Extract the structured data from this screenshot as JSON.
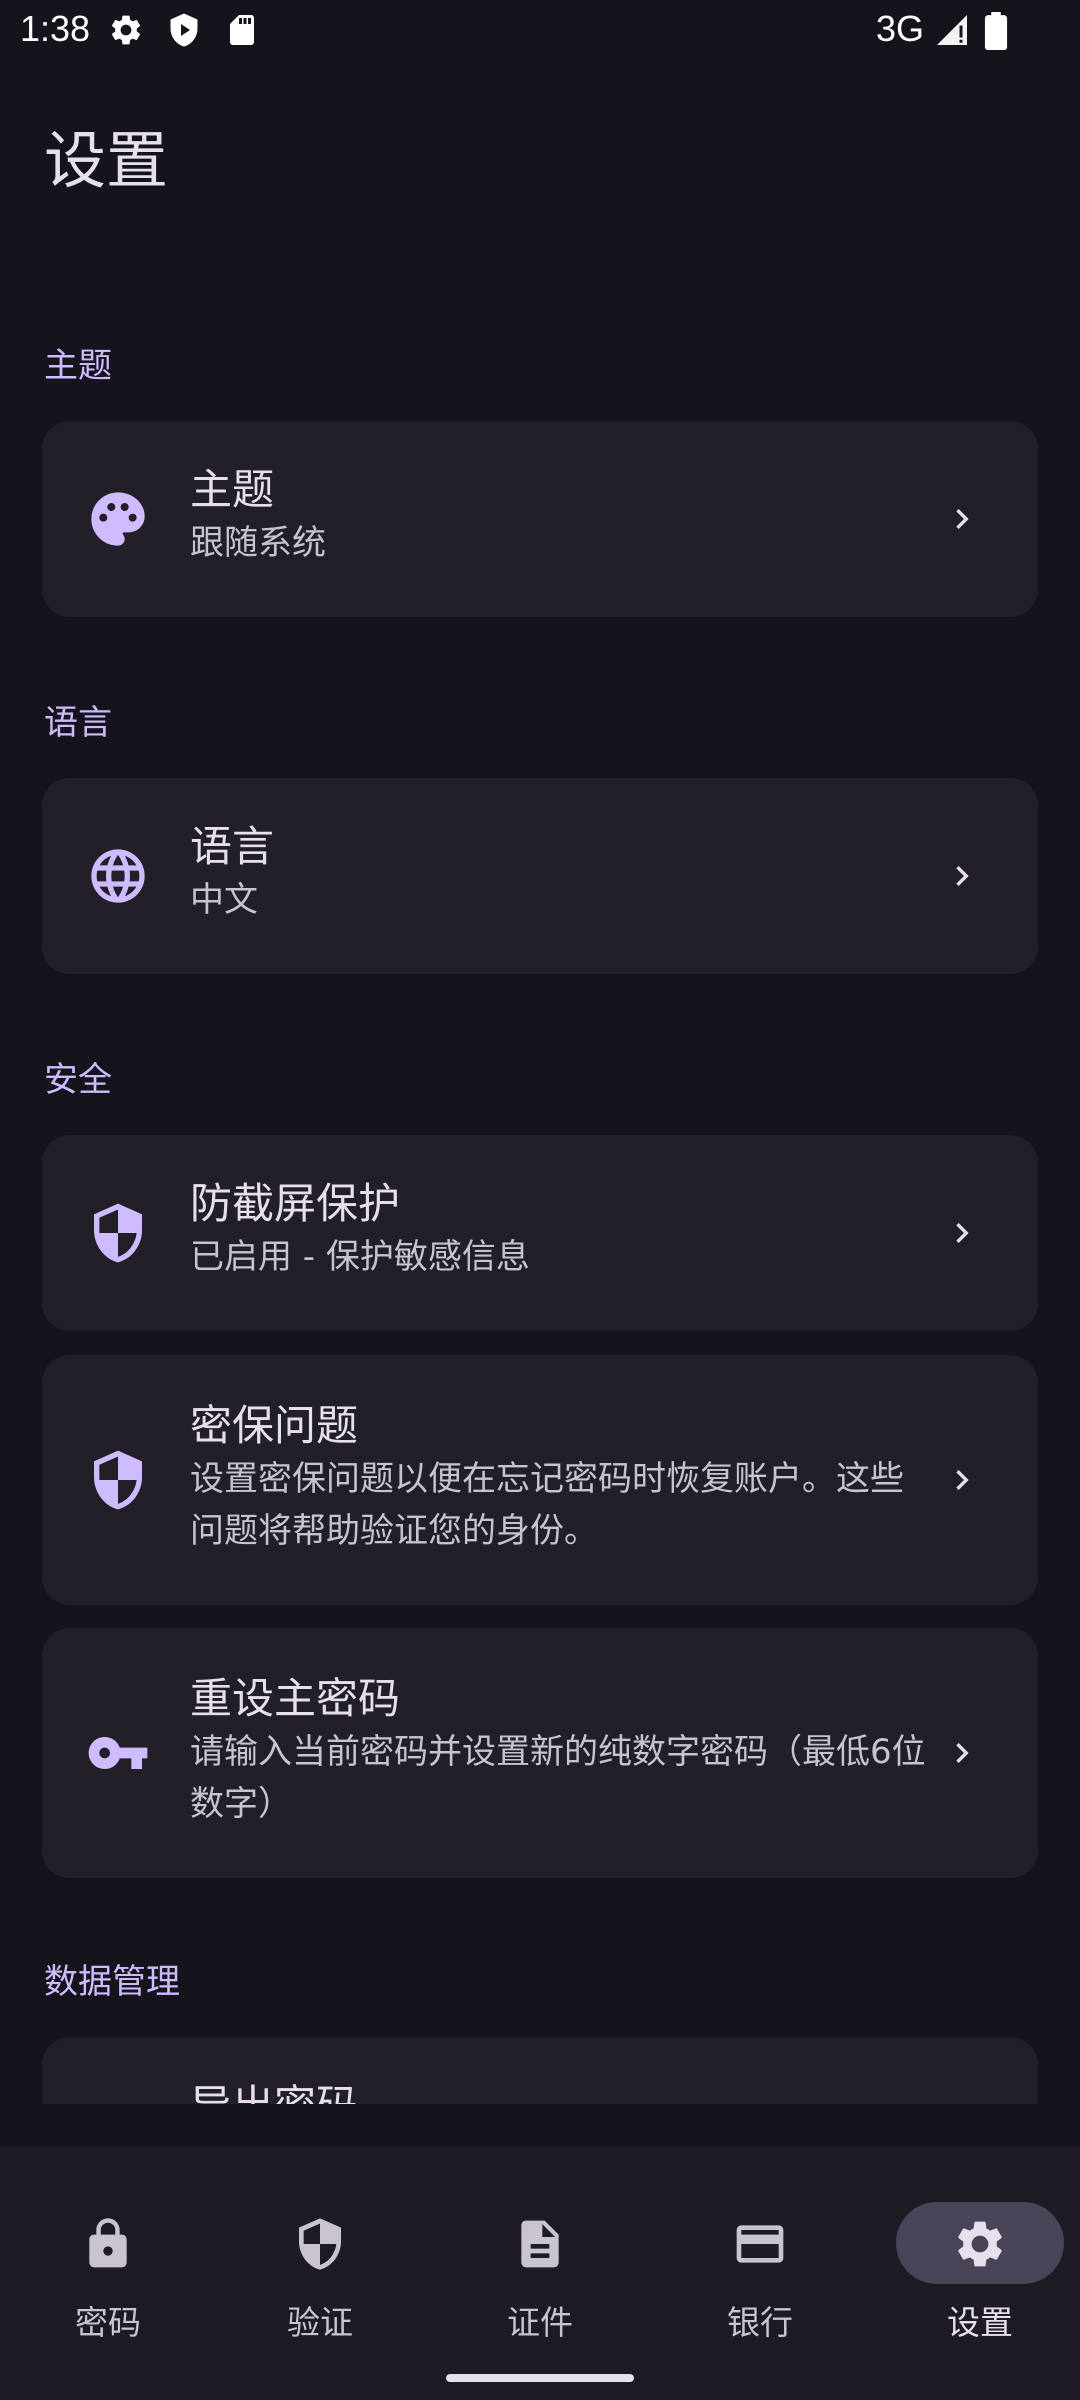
{
  "status_bar": {
    "time": "1:38",
    "network": "3G",
    "icons": [
      "settings-icon",
      "play-protect-icon",
      "sd-card-icon",
      "signal-icon",
      "battery-icon"
    ]
  },
  "page": {
    "title": "设置"
  },
  "sections": {
    "theme": {
      "title": "主题",
      "card": {
        "title": "主题",
        "subtitle": "跟随系统",
        "icon": "palette-icon"
      }
    },
    "language": {
      "title": "语言",
      "card": {
        "title": "语言",
        "subtitle": "中文",
        "icon": "globe-icon"
      }
    },
    "security": {
      "title": "安全",
      "cards": [
        {
          "title": "防截屏保护",
          "subtitle": "已启用 - 保护敏感信息",
          "icon": "shield-icon"
        },
        {
          "title": "密保问题",
          "subtitle": "设置密保问题以便在忘记密码时恢复账户。这些问题将帮助验证您的身份。",
          "icon": "shield-icon"
        },
        {
          "title": "重设主密码",
          "subtitle": "请输入当前密码并设置新的纯数字密码（最低6位数字）",
          "icon": "key-icon"
        }
      ]
    },
    "data": {
      "title": "数据管理",
      "cards": [
        {
          "title": "导出密码"
        }
      ]
    }
  },
  "bottom_nav": {
    "items": [
      {
        "label": "密码",
        "icon": "lock-icon"
      },
      {
        "label": "验证",
        "icon": "shield-icon"
      },
      {
        "label": "证件",
        "icon": "document-icon"
      },
      {
        "label": "银行",
        "icon": "credit-card-icon"
      },
      {
        "label": "设置",
        "icon": "gear-icon",
        "active": true
      }
    ]
  },
  "colors": {
    "background": "#15131b",
    "card": "#221f29",
    "accent": "#cfbcff",
    "nav_background": "#1e1b24",
    "nav_active_pill": "#4a4458"
  }
}
